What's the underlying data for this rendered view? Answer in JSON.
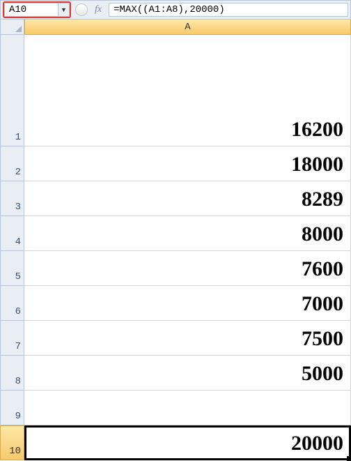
{
  "formula_bar": {
    "name_box": "A10",
    "formula": "=MAX((A1:A8),20000)",
    "fx_label": "fx"
  },
  "columns": [
    "A"
  ],
  "rows": [
    {
      "num": "1",
      "value": "16200",
      "selected": false
    },
    {
      "num": "2",
      "value": "18000",
      "selected": false
    },
    {
      "num": "3",
      "value": "8289",
      "selected": false
    },
    {
      "num": "4",
      "value": "8000",
      "selected": false
    },
    {
      "num": "5",
      "value": "7600",
      "selected": false
    },
    {
      "num": "6",
      "value": "7000",
      "selected": false
    },
    {
      "num": "7",
      "value": "7500",
      "selected": false
    },
    {
      "num": "8",
      "value": "5000",
      "selected": false
    },
    {
      "num": "9",
      "value": "",
      "selected": false
    },
    {
      "num": "10",
      "value": "20000",
      "selected": true
    }
  ]
}
